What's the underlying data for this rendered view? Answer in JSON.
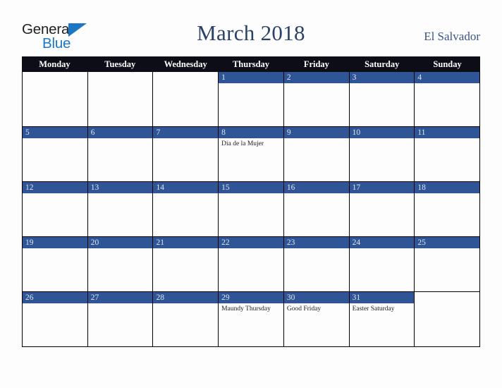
{
  "brand": {
    "line1": "General",
    "line2": "Blue",
    "triangle_color": "#1b77c4",
    "text_color": "#201f1f"
  },
  "header": {
    "month_title": "March 2018",
    "country": "El Salvador",
    "title_color": "#2b4268",
    "country_color": "#37558a"
  },
  "calendar": {
    "weekday_headers": [
      "Monday",
      "Tuesday",
      "Wednesday",
      "Thursday",
      "Friday",
      "Saturday",
      "Sunday"
    ],
    "header_bg": "#0d0d17",
    "date_bar_color": "#2f5597",
    "date_text_color": "#dfe6f2",
    "weeks": [
      [
        {
          "date": "",
          "blank": true,
          "events": []
        },
        {
          "date": "",
          "blank": true,
          "events": []
        },
        {
          "date": "",
          "blank": true,
          "events": []
        },
        {
          "date": "1",
          "blank": false,
          "events": []
        },
        {
          "date": "2",
          "blank": false,
          "events": []
        },
        {
          "date": "3",
          "blank": false,
          "events": []
        },
        {
          "date": "4",
          "blank": false,
          "events": []
        }
      ],
      [
        {
          "date": "5",
          "blank": false,
          "events": []
        },
        {
          "date": "6",
          "blank": false,
          "events": []
        },
        {
          "date": "7",
          "blank": false,
          "events": []
        },
        {
          "date": "8",
          "blank": false,
          "events": [
            "Día de la Mujer"
          ]
        },
        {
          "date": "9",
          "blank": false,
          "events": []
        },
        {
          "date": "10",
          "blank": false,
          "events": []
        },
        {
          "date": "11",
          "blank": false,
          "events": []
        }
      ],
      [
        {
          "date": "12",
          "blank": false,
          "events": []
        },
        {
          "date": "13",
          "blank": false,
          "events": []
        },
        {
          "date": "14",
          "blank": false,
          "events": []
        },
        {
          "date": "15",
          "blank": false,
          "events": []
        },
        {
          "date": "16",
          "blank": false,
          "events": []
        },
        {
          "date": "17",
          "blank": false,
          "events": []
        },
        {
          "date": "18",
          "blank": false,
          "events": []
        }
      ],
      [
        {
          "date": "19",
          "blank": false,
          "events": []
        },
        {
          "date": "20",
          "blank": false,
          "events": []
        },
        {
          "date": "21",
          "blank": false,
          "events": []
        },
        {
          "date": "22",
          "blank": false,
          "events": []
        },
        {
          "date": "23",
          "blank": false,
          "events": []
        },
        {
          "date": "24",
          "blank": false,
          "events": []
        },
        {
          "date": "25",
          "blank": false,
          "events": []
        }
      ],
      [
        {
          "date": "26",
          "blank": false,
          "events": []
        },
        {
          "date": "27",
          "blank": false,
          "events": []
        },
        {
          "date": "28",
          "blank": false,
          "events": []
        },
        {
          "date": "29",
          "blank": false,
          "events": [
            "Maundy Thursday"
          ]
        },
        {
          "date": "30",
          "blank": false,
          "events": [
            "Good Friday"
          ]
        },
        {
          "date": "31",
          "blank": false,
          "events": [
            "Easter Saturday"
          ]
        },
        {
          "date": "",
          "blank": true,
          "events": []
        }
      ]
    ]
  }
}
